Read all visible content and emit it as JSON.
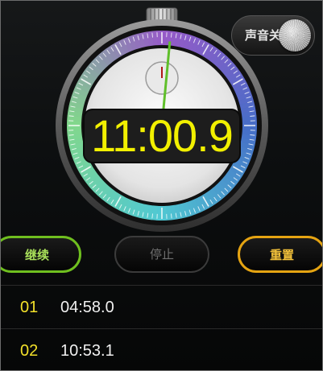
{
  "stopwatch": {
    "time": "11:00.9",
    "hand_seconds": 0.9
  },
  "sound_toggle": {
    "label": "声音关",
    "state": "off"
  },
  "buttons": {
    "continue": "继续",
    "stop": "停止",
    "reset": "重置"
  },
  "laps": [
    {
      "number": "01",
      "time": "04:58.0"
    },
    {
      "number": "02",
      "time": "10:53.1"
    }
  ],
  "colors": {
    "display_text": "#f2f000",
    "continue_accent": "#6fbf1f",
    "reset_accent": "#e5a412",
    "lap_number": "#f2e02a"
  }
}
